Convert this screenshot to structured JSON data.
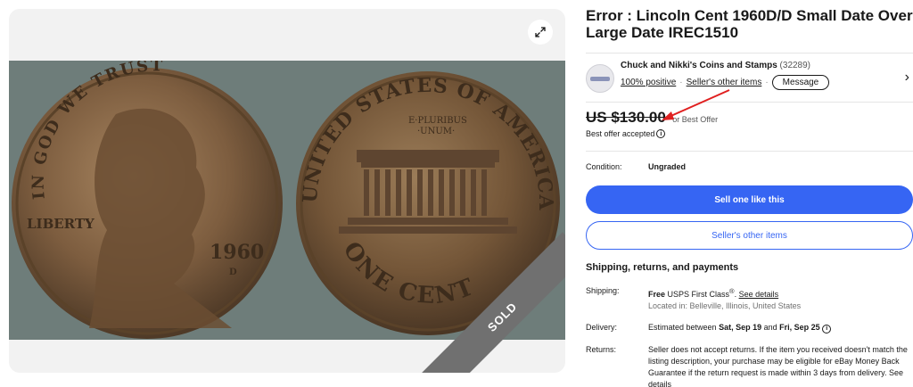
{
  "listing": {
    "title": "Error : Lincoln Cent 1960D/D Small Date Over Large Date IREC1510",
    "sold_label": "SOLD"
  },
  "seller": {
    "name": "Chuck and Nikki's Coins and Stamps",
    "feedback_count": "(32289)",
    "positive": "100% positive",
    "separator": "·",
    "other_items_link": "Seller's other items",
    "message_label": "Message",
    "chevron": "›"
  },
  "price": {
    "amount": "US $130.00",
    "best_offer": "or Best Offer",
    "accepted": "Best offer accepted",
    "info_glyph": "i"
  },
  "condition": {
    "label": "Condition:",
    "value": "Ungraded"
  },
  "buttons": {
    "sell_one": "Sell one like this",
    "other_items": "Seller's other items"
  },
  "shipping": {
    "heading": "Shipping, returns, and payments",
    "shipping_label": "Shipping:",
    "shipping_free": "Free",
    "shipping_service": "USPS First Class",
    "shipping_reg": "®",
    "shipping_link": "See details",
    "location": "Located in: Belleville, Illinois, United States",
    "delivery_label": "Delivery:",
    "delivery_prefix": "Estimated between",
    "delivery_start": "Sat, Sep 19",
    "delivery_and": "and",
    "delivery_end": "Fri, Sep 25",
    "returns_label": "Returns:",
    "returns_text": "Seller does not accept returns. If the item you received doesn't match the listing description, your purchase may be eligible for eBay Money Back Guarantee if the return request is made within 3 days from delivery. See details"
  },
  "coin": {
    "obverse_motto": "IN GOD WE TRUST",
    "obverse_liberty": "LIBERTY",
    "obverse_year": "1960",
    "obverse_mint": "D",
    "reverse_top": "UNITED STATES OF AMERICA",
    "reverse_motto_1": "E·PLURIBUS",
    "reverse_motto_2": "·UNUM·",
    "reverse_bottom": "ONE CENT"
  },
  "colors": {
    "accent": "#3665f3",
    "ribbon": "#707070",
    "arrow": "#e02020",
    "coin": "#8a6a48"
  }
}
